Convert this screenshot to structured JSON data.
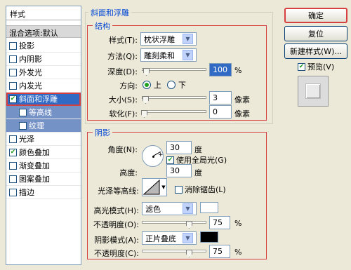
{
  "sidebar": {
    "title": "样式",
    "blend_label": "混合选项:默认",
    "items": [
      {
        "label": "投影",
        "checked": false
      },
      {
        "label": "内阴影",
        "checked": false
      },
      {
        "label": "外发光",
        "checked": false
      },
      {
        "label": "内发光",
        "checked": false
      },
      {
        "label": "斜面和浮雕",
        "checked": true
      },
      {
        "label": "等高线",
        "checked": false
      },
      {
        "label": "纹理",
        "checked": false
      },
      {
        "label": "光泽",
        "checked": false
      },
      {
        "label": "颜色叠加",
        "checked": true
      },
      {
        "label": "渐变叠加",
        "checked": false
      },
      {
        "label": "图案叠加",
        "checked": false
      },
      {
        "label": "描边",
        "checked": false
      }
    ]
  },
  "bevel": {
    "title": "斜面和浮雕",
    "structure_title": "结构",
    "style_label": "样式(T):",
    "style_value": "枕状浮雕",
    "technique_label": "方法(Q):",
    "technique_value": "雕刻柔和",
    "depth_label": "深度(D):",
    "depth_value": "100",
    "depth_unit": "%",
    "direction_label": "方向:",
    "direction_up": "上",
    "direction_down": "下",
    "size_label": "大小(S):",
    "size_value": "3",
    "size_unit": "像素",
    "soften_label": "软化(F):",
    "soften_value": "0",
    "soften_unit": "像素"
  },
  "shading": {
    "title": "阴影",
    "angle_label": "角度(N):",
    "angle_value": "30",
    "angle_unit": "度",
    "global_light_label": "使用全局光(G)",
    "altitude_label": "高度:",
    "altitude_value": "30",
    "altitude_unit": "度",
    "gloss_label": "光泽等高线:",
    "anti_alias_label": "消除锯齿(L)",
    "highlight_mode_label": "高光模式(H):",
    "highlight_mode_value": "滤色",
    "highlight_opacity_label": "不透明度(O):",
    "highlight_opacity_value": "75",
    "shadow_mode_label": "阴影模式(A):",
    "shadow_mode_value": "正片叠底",
    "shadow_opacity_label": "不透明度(C):",
    "shadow_opacity_value": "75",
    "percent": "%"
  },
  "buttons": {
    "ok": "确定",
    "reset": "复位",
    "new_style": "新建样式(W)...",
    "preview": "预览(V)"
  },
  "colors": {
    "highlight_color": "#ffffff",
    "shadow_color": "#000000"
  }
}
